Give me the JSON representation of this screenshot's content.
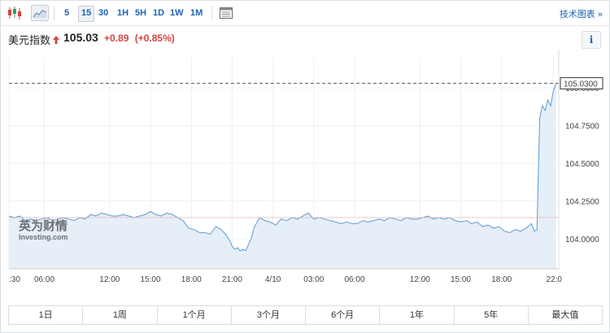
{
  "toolbar": {
    "intervals": [
      "5",
      "15",
      "30",
      "1H",
      "5H",
      "1D",
      "1W",
      "1M"
    ],
    "active_interval": "15",
    "tech_chart_label": "技术图表 »"
  },
  "header": {
    "name": "美元指数",
    "price": "105.03",
    "change": "+0.89",
    "change_pct": "(+0.85%)",
    "info_label": "i",
    "up_color": "#d64541"
  },
  "watermark": {
    "cn": "英为财情",
    "en": "Investing.com"
  },
  "chart_data": {
    "type": "area",
    "ylim": [
      103.8,
      105.2
    ],
    "yticks": [
      "104.0000",
      "104.2500",
      "104.5000",
      "104.7500",
      "105.0000"
    ],
    "ytick_values": [
      104.0,
      104.25,
      104.5,
      104.75,
      105.0
    ],
    "last_price_label": "105.0300",
    "last_price": 105.03,
    "reference_price": 104.14,
    "xlim": [
      0,
      202
    ],
    "xticks": [
      {
        "label": ":30",
        "x": 0
      },
      {
        "label": "06:00",
        "x": 13
      },
      {
        "label": "12:00",
        "x": 37
      },
      {
        "label": "15:00",
        "x": 52
      },
      {
        "label": "18:00",
        "x": 67
      },
      {
        "label": "21:00",
        "x": 82
      },
      {
        "label": "4/10",
        "x": 97
      },
      {
        "label": "03:00",
        "x": 112
      },
      {
        "label": "06:00",
        "x": 127
      },
      {
        "label": "12:00",
        "x": 151
      },
      {
        "label": "15:00",
        "x": 166
      },
      {
        "label": "18:00",
        "x": 181
      },
      {
        "label": "22:0",
        "x": 200
      }
    ],
    "x": [
      0,
      2,
      4,
      6,
      8,
      10,
      12,
      14,
      16,
      18,
      20,
      22,
      24,
      26,
      28,
      30,
      32,
      34,
      36,
      38,
      40,
      42,
      44,
      46,
      48,
      50,
      52,
      54,
      56,
      58,
      60,
      62,
      64,
      66,
      68,
      70,
      72,
      74,
      76,
      78,
      80,
      81,
      82,
      83,
      84,
      85,
      86,
      87,
      88,
      89,
      90,
      92,
      94,
      96,
      98,
      100,
      102,
      104,
      106,
      108,
      110,
      112,
      114,
      116,
      118,
      120,
      122,
      124,
      126,
      128,
      130,
      132,
      134,
      136,
      138,
      140,
      142,
      144,
      146,
      148,
      150,
      152,
      154,
      156,
      158,
      160,
      162,
      164,
      166,
      168,
      170,
      172,
      174,
      176,
      178,
      180,
      182,
      184,
      186,
      188,
      190,
      192,
      193,
      194,
      195,
      196,
      197,
      198,
      199,
      200,
      201
    ],
    "y": [
      104.15,
      104.14,
      104.15,
      104.12,
      104.13,
      104.12,
      104.13,
      104.14,
      104.12,
      104.13,
      104.14,
      104.13,
      104.12,
      104.14,
      104.13,
      104.16,
      104.15,
      104.17,
      104.16,
      104.15,
      104.15,
      104.16,
      104.15,
      104.14,
      104.15,
      104.16,
      104.18,
      104.16,
      104.15,
      104.17,
      104.16,
      104.14,
      104.12,
      104.07,
      104.06,
      104.04,
      104.04,
      104.03,
      104.08,
      104.06,
      104.02,
      103.99,
      103.95,
      103.93,
      103.94,
      103.92,
      103.93,
      103.92,
      103.96,
      104.0,
      104.07,
      104.14,
      104.12,
      104.11,
      104.09,
      104.13,
      104.12,
      104.14,
      104.13,
      104.15,
      104.17,
      104.13,
      104.14,
      104.13,
      104.12,
      104.11,
      104.1,
      104.11,
      104.1,
      104.1,
      104.12,
      104.11,
      104.12,
      104.13,
      104.12,
      104.14,
      104.13,
      104.12,
      104.14,
      104.13,
      104.13,
      104.14,
      104.15,
      104.13,
      104.14,
      104.13,
      104.14,
      104.12,
      104.11,
      104.12,
      104.1,
      104.11,
      104.08,
      104.09,
      104.07,
      104.08,
      104.05,
      104.04,
      104.06,
      104.05,
      104.07,
      104.1,
      104.05,
      104.06,
      104.8,
      104.88,
      104.85,
      104.92,
      104.88,
      104.98,
      105.03
    ],
    "line_color": "#5b9bd5",
    "fill_color": "#e6eef7"
  },
  "ranges": [
    "1日",
    "1周",
    "1个月",
    "3个月",
    "6个月",
    "1年",
    "5年",
    "最大值"
  ]
}
